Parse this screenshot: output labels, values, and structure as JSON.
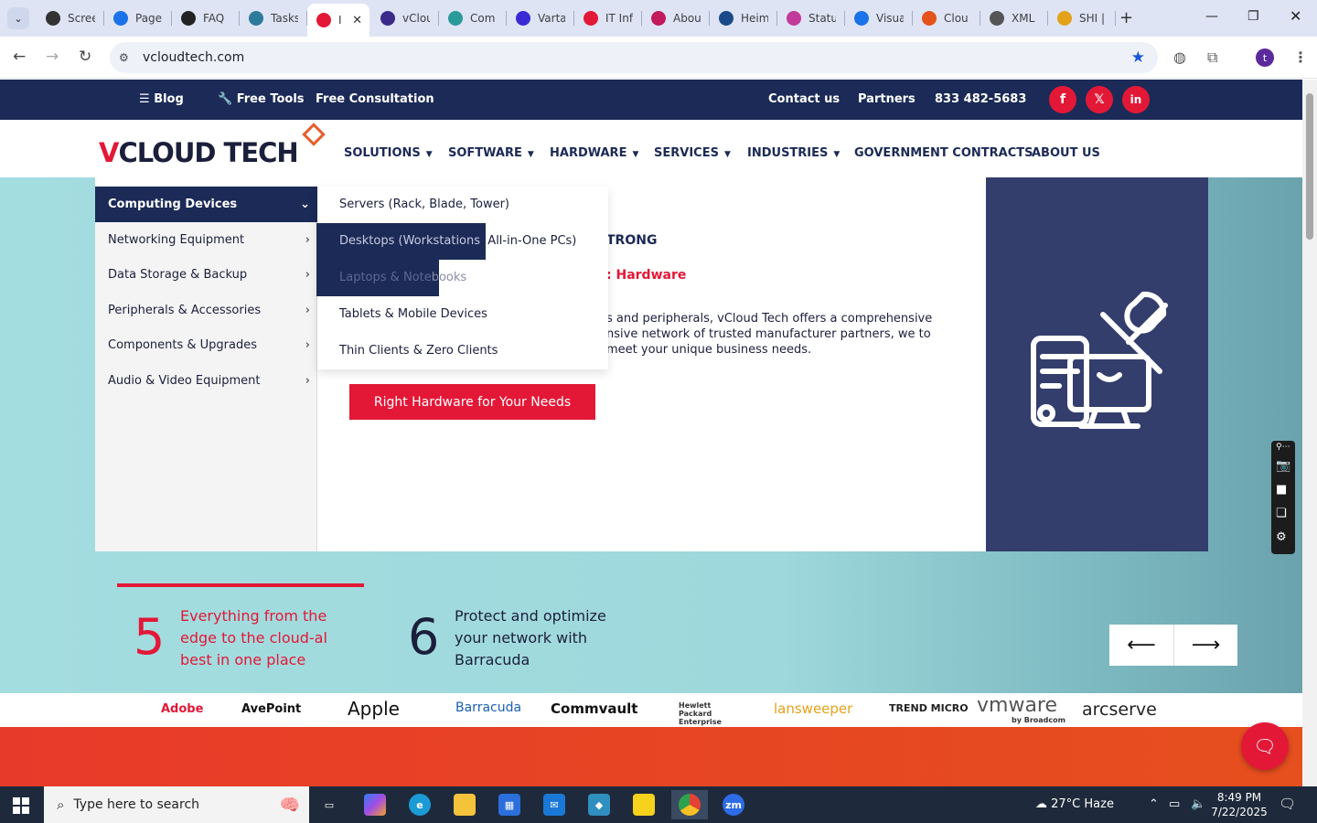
{
  "browser": {
    "tabs": [
      {
        "label": "Scree",
        "color": "#333333"
      },
      {
        "label": "Page",
        "color": "#1a73e8"
      },
      {
        "label": "FAQ",
        "color": "#222222"
      },
      {
        "label": "Tasks",
        "color": "#2d7a9a"
      },
      {
        "label": "I",
        "color": "#e31837",
        "active": true
      },
      {
        "label": "vClou",
        "color": "#3b2a8a"
      },
      {
        "label": "Com",
        "color": "#2a9a9a"
      },
      {
        "label": "Varta",
        "color": "#3a2ad6"
      },
      {
        "label": "IT Inf",
        "color": "#e31837"
      },
      {
        "label": "Abou",
        "color": "#c21a5a"
      },
      {
        "label": "Heim",
        "color": "#1a4a8a"
      },
      {
        "label": "Statu",
        "color": "#c23a9a"
      },
      {
        "label": "Visua",
        "color": "#1a73e8"
      },
      {
        "label": "Clou",
        "color": "#e3531a"
      },
      {
        "label": "XML",
        "color": "#555555"
      },
      {
        "label": "SHI |",
        "color": "#e3a21a"
      }
    ],
    "url": "vcloudtech.com",
    "profile_initial": "t"
  },
  "topbar": {
    "blog": "Blog",
    "free_tools": "Free Tools",
    "free_consultation": "Free Consultation",
    "contact": "Contact us",
    "partners": "Partners",
    "phone": "833 482-5683",
    "social": [
      "f",
      "𝕏",
      "in"
    ],
    "accent": "#e31837",
    "navy": "#1b2a57"
  },
  "logo": {
    "v": "V",
    "rest": "CLOUD TECH"
  },
  "nav": {
    "solutions": "SOLUTIONS",
    "software": "SOFTWARE",
    "hardware": "HARDWARE",
    "services": "SERVICES",
    "industries": "INDUSTRIES",
    "government": "GOVERNMENT CONTRACTS",
    "about": "ABOUT US"
  },
  "dropdown": {
    "categories": [
      "Computing Devices",
      "Networking Equipment",
      "Data Storage & Backup",
      "Peripherals & Accessories",
      "Components & Upgrades",
      "Audio & Video Equipment"
    ],
    "subitems": {
      "servers": "Servers (Rack, Blade, Tower)",
      "desktops_a": "Desktops (Workstations",
      "desktops_b": ", All-in-One PCs)",
      "laptops_a": "Laptops & Note",
      "laptops_b": "books",
      "tablets": "Tablets & Mobile Devices",
      "thin": "Thin Clients & Zero Clients"
    }
  },
  "hero": {
    "heading_fragment": "TRONG",
    "subheading_fragment": ": Hardware",
    "body_fragment": "s and peripherals, vCloud Tech offers a comprehensive nsive network of trusted manufacturer partners, we to meet your unique business needs.",
    "cta": "Right Hardware for Your Needs"
  },
  "stats": [
    {
      "number": "5",
      "text": "Everything from the edge to the cloud-al best in one place",
      "color": "#e31837"
    },
    {
      "number": "6",
      "text": "Protect and optimize your network with Barracuda",
      "color": "#1b1f3b"
    }
  ],
  "carousel": {
    "prev": "⟵",
    "next": "⟶"
  },
  "partners": [
    "Adobe",
    "AvePoint",
    "Apple",
    "Barracuda",
    "Commvault",
    "Hewlett Packard Enterprise",
    "lansweeper",
    "TREND MICRO",
    "vmware",
    "by Broadcom",
    "arcserve"
  ],
  "taskbar": {
    "search_placeholder": "Type here to search",
    "weather": "27°C  Haze",
    "time": "8:49 PM",
    "date": "7/22/2025"
  }
}
